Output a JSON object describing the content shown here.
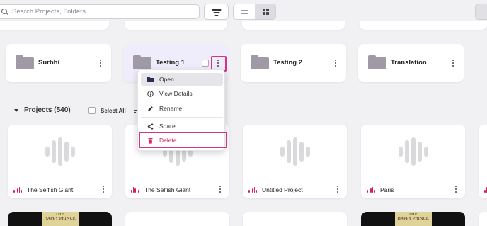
{
  "search": {
    "placeholder": "Search Projects, Folders"
  },
  "folders": [
    {
      "name": "Surbhi"
    },
    {
      "name": "Testing 1"
    },
    {
      "name": "Testing 2"
    },
    {
      "name": "Translation"
    }
  ],
  "context_menu": {
    "items": [
      {
        "label": "Open",
        "icon": "folder-icon"
      },
      {
        "label": "View Details",
        "icon": "info-icon"
      },
      {
        "label": "Rename",
        "icon": "pencil-icon"
      },
      {
        "label": "Share",
        "icon": "share-icon"
      },
      {
        "label": "Delete",
        "icon": "trash-icon"
      }
    ]
  },
  "projects_section": {
    "title": "Projects (540)",
    "select_all": "Select All"
  },
  "projects": [
    {
      "name": "The Selfish Giant"
    },
    {
      "name": "The Selfish Giant"
    },
    {
      "name": "Untitled Project"
    },
    {
      "name": "Paris"
    }
  ],
  "book_cover": {
    "line1": "THE",
    "line2": "HAPPY PRINCE"
  },
  "colors": {
    "accent": "#d63384",
    "audio": "#d61f5a",
    "delete": "#e0245e",
    "selected_card": "#efecfb"
  }
}
